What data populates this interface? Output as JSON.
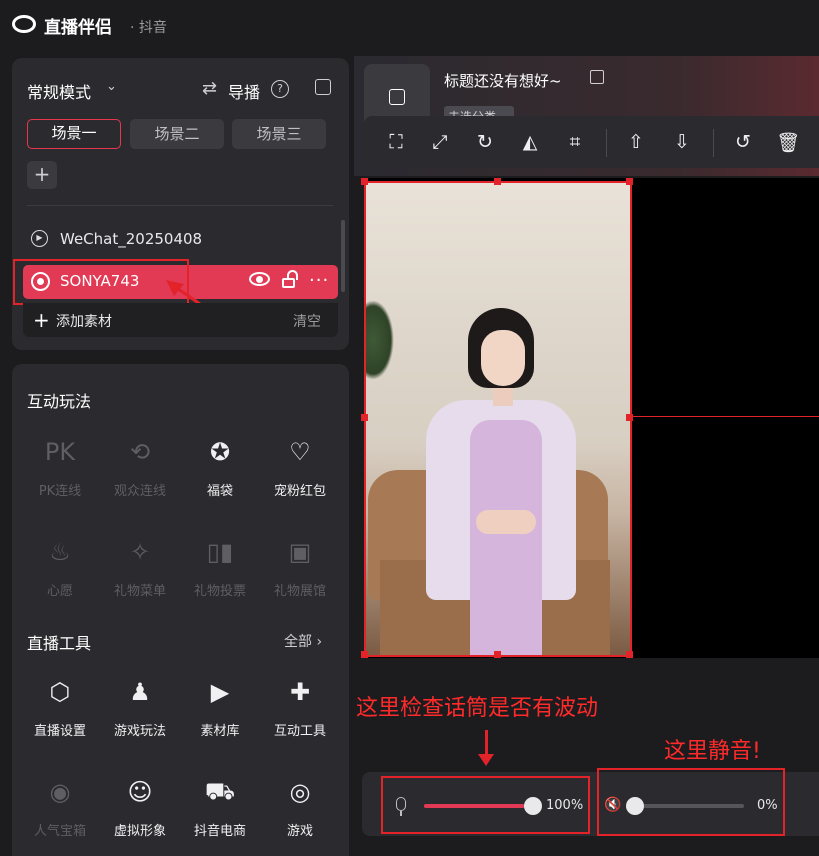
{
  "app": {
    "title": "直播伴侣",
    "platform": "· 抖音"
  },
  "scene_panel": {
    "mode_label": "常规模式",
    "director_label": "导播",
    "help_symbol": "?",
    "tabs": [
      {
        "label": "场景一",
        "active": true
      },
      {
        "label": "场景二",
        "active": false
      },
      {
        "label": "场景三",
        "active": false
      }
    ],
    "add_scene_symbol": "+",
    "sources": [
      {
        "label": "WeChat_20250408",
        "icon": "play-circle-icon",
        "selected": false
      },
      {
        "label": "SONYA743",
        "icon": "camera-icon",
        "selected": true
      }
    ],
    "add_material_label": "添加素材",
    "clear_label": "清空"
  },
  "interactive_section": {
    "title": "互动玩法",
    "items": [
      {
        "label": "PK连线",
        "icon_text": "PK",
        "enabled": false
      },
      {
        "label": "观众连线",
        "icon_text": "⟲",
        "enabled": false
      },
      {
        "label": "福袋",
        "icon_text": "✪",
        "enabled": true
      },
      {
        "label": "宠粉红包",
        "icon_text": "♡",
        "enabled": true
      },
      {
        "label": "心愿",
        "icon_text": "♨",
        "enabled": false
      },
      {
        "label": "礼物菜单",
        "icon_text": "✧",
        "enabled": false
      },
      {
        "label": "礼物投票",
        "icon_text": "▯▮",
        "enabled": false
      },
      {
        "label": "礼物展馆",
        "icon_text": "▣",
        "enabled": false
      }
    ]
  },
  "tools_section": {
    "title": "直播工具",
    "all_label": "全部",
    "items": [
      {
        "label": "直播设置",
        "icon_text": "⬡",
        "enabled": true
      },
      {
        "label": "游戏玩法",
        "icon_text": "♟",
        "enabled": true
      },
      {
        "label": "素材库",
        "icon_text": "▶",
        "enabled": true
      },
      {
        "label": "互动工具",
        "icon_text": "✚",
        "enabled": true
      },
      {
        "label": "人气宝箱",
        "icon_text": "◉",
        "enabled": false
      },
      {
        "label": "虚拟形象",
        "icon_text": "☺",
        "enabled": true
      },
      {
        "label": "抖音电商",
        "icon_text": "⛟",
        "enabled": true
      },
      {
        "label": "游戏",
        "icon_text": "◎",
        "enabled": true
      }
    ]
  },
  "stream_header": {
    "title": "标题还没有想好~",
    "category_chip": "去选分类"
  },
  "toolbar": {
    "buttons": [
      {
        "name": "fullscreen-icon",
        "glyph": "⛶"
      },
      {
        "name": "fit-screen-icon",
        "glyph": "⤢"
      },
      {
        "name": "rotate-icon",
        "glyph": "↻"
      },
      {
        "name": "flip-horizontal-icon",
        "glyph": "◭"
      },
      {
        "name": "crop-icon",
        "glyph": "⌗"
      },
      {
        "name": "move-top-icon",
        "glyph": "⇧"
      },
      {
        "name": "move-bottom-icon",
        "glyph": "⇩"
      },
      {
        "name": "undo-icon",
        "glyph": "↺"
      },
      {
        "name": "delete-icon",
        "glyph": "🗑"
      }
    ]
  },
  "annotations": {
    "mic_note": "这里检查话筒是否有波动",
    "mute_note": "这里静音!"
  },
  "audio": {
    "mic": {
      "level_percent": 100,
      "value_text": "100%"
    },
    "speaker": {
      "level_percent": 0,
      "value_text": "0%",
      "muted": true
    }
  },
  "colors": {
    "accent": "#e23a55",
    "annotation_red": "#e3232a"
  }
}
